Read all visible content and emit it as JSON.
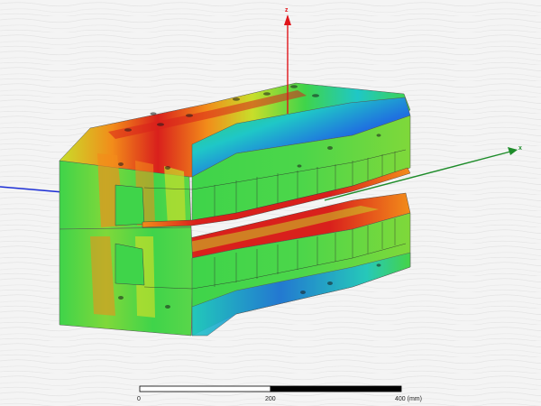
{
  "viewport": {
    "background": "#f4f4f4",
    "background_texture": "#e6e6e6"
  },
  "triad": {
    "z_label": "z",
    "x_label": "x",
    "z_color": "#e0151b",
    "x_color": "#1e8c2a",
    "y_color": "#1d2fd6"
  },
  "model": {
    "description_colors": {
      "low": "#1f6fe0",
      "mid_low": "#1fc7c7",
      "mid": "#3fd44a",
      "mid_high": "#c8de2a",
      "high": "#f28c1a",
      "max": "#d9201c"
    }
  },
  "scale_bar": {
    "ticks": [
      "0",
      "200",
      "400 (mm)"
    ],
    "light_color": "#ffffff",
    "dark_color": "#000000"
  }
}
